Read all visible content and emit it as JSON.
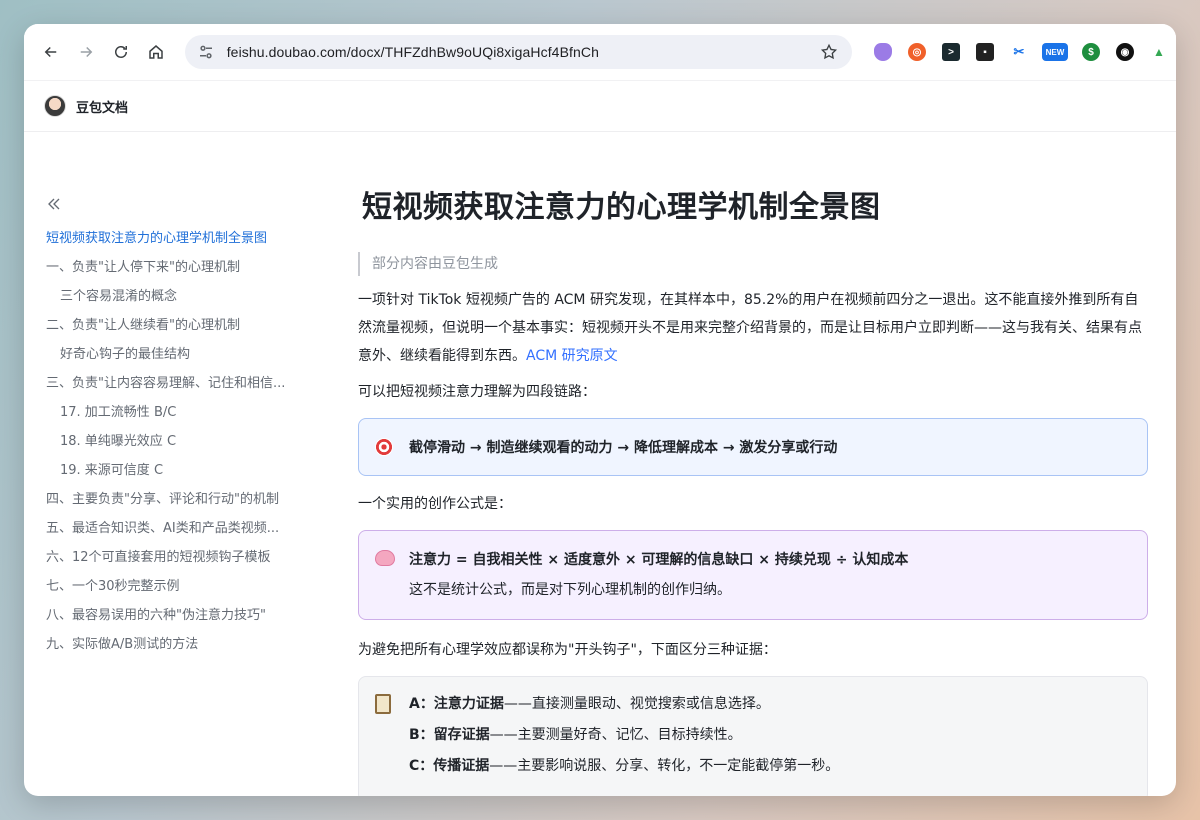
{
  "browser": {
    "url": "feishu.doubao.com/docx/THFZdhBw9oUQi8xigaHcf4BfnCh",
    "new_badge": "NEW",
    "extensions": [
      "ext-purple-icon",
      "ext-orange-icon",
      "ext-terminal-icon",
      "ext-dots-icon",
      "ext-scissors-icon",
      "ext-new-icon",
      "ext-green-icon",
      "ext-dark-icon",
      "ext-leaf-icon"
    ]
  },
  "app": {
    "name": "豆包文档"
  },
  "outline": {
    "items": [
      {
        "label": "短视频获取注意力的心理学机制全景图",
        "level": 0,
        "active": true
      },
      {
        "label": "一、负责\"让人停下来\"的心理机制",
        "level": 1
      },
      {
        "label": "三个容易混淆的概念",
        "level": 2
      },
      {
        "label": "二、负责\"让人继续看\"的心理机制",
        "level": 1
      },
      {
        "label": "好奇心钩子的最佳结构",
        "level": 2
      },
      {
        "label": "三、负责\"让内容容易理解、记住和相信...",
        "level": 1
      },
      {
        "label": "17. 加工流畅性 B/C",
        "level": 2
      },
      {
        "label": "18. 单纯曝光效应 C",
        "level": 2
      },
      {
        "label": "19. 来源可信度 C",
        "level": 2
      },
      {
        "label": "四、主要负责\"分享、评论和行动\"的机制",
        "level": 1
      },
      {
        "label": "五、最适合知识类、AI类和产品类视频...",
        "level": 1
      },
      {
        "label": "六、12个可直接套用的短视频钩子模板",
        "level": 1
      },
      {
        "label": "七、一个30秒完整示例",
        "level": 1
      },
      {
        "label": "八、最容易误用的六种\"伪注意力技巧\"",
        "level": 1
      },
      {
        "label": "九、实际做A/B测试的方法",
        "level": 1
      }
    ]
  },
  "doc": {
    "title": "短视频获取注意力的心理学机制全景图",
    "quote": "部分内容由豆包生成",
    "intro_text": "一项针对 TikTok 短视频广告的 ACM 研究发现，在其样本中，85.2%的用户在视频前四分之一退出。这不能直接外推到所有自然流量视频，但说明一个基本事实：短视频开头不是用来完整介绍背景的，而是让目标用户立即判断——这与我有关、结果有点意外、继续看能得到东西。",
    "intro_link": "ACM 研究原文",
    "chain_intro": "可以把短视频注意力理解为四段链路：",
    "chain_callout": "截停滑动 → 制造继续观看的动力 → 降低理解成本 → 激发分享或行动",
    "formula_intro": "一个实用的创作公式是：",
    "formula_line1": "注意力 = 自我相关性 × 适度意外 × 可理解的信息缺口 × 持续兑现 ÷ 认知成本",
    "formula_line2": "这不是统计公式，而是对下列心理机制的创作归纳。",
    "evidence_intro": "为避免把所有心理学效应都误称为\"开头钩子\"，下面区分三种证据：",
    "evidence": [
      {
        "label": "A：注意力证据",
        "text": "——直接测量眼动、视觉搜索或信息选择。"
      },
      {
        "label": "B：留存证据",
        "text": "——主要测量好奇、记忆、目标持续性。"
      },
      {
        "label": "C：传播证据",
        "text": "——主要影响说服、分享、转化，不一定能截停第一秒。"
      }
    ]
  },
  "colors": {
    "link": "#3370ff",
    "active_outline": "#1f6fd8",
    "blue_callout": "#f0f5ff",
    "purple_callout": "#f6f0ff"
  }
}
